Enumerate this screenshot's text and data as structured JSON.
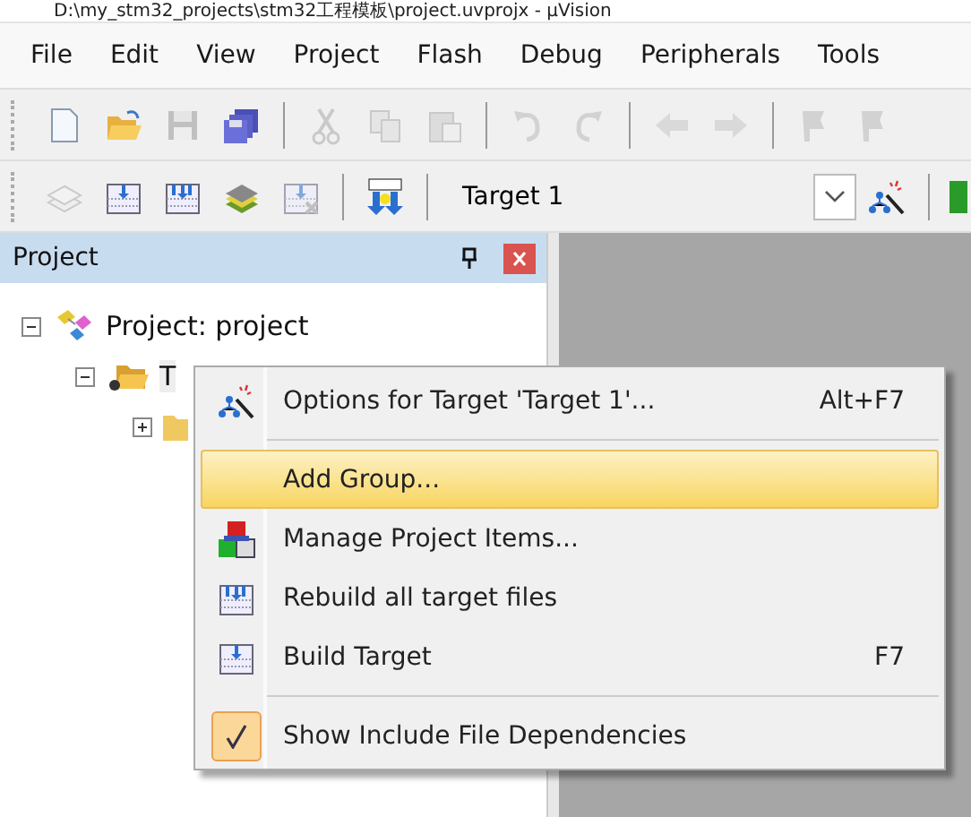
{
  "window": {
    "title": "D:\\my_stm32_projects\\stm32工程模板\\project.uvprojx - µVision"
  },
  "menu": [
    "File",
    "Edit",
    "View",
    "Project",
    "Flash",
    "Debug",
    "Peripherals",
    "Tools"
  ],
  "toolbar": [
    {
      "kind": "new",
      "disabled": false
    },
    {
      "kind": "open",
      "disabled": false
    },
    {
      "kind": "save",
      "disabled": true
    },
    {
      "kind": "saveall",
      "disabled": false
    },
    {
      "kind": "sep"
    },
    {
      "kind": "cut",
      "disabled": true
    },
    {
      "kind": "copy",
      "disabled": true
    },
    {
      "kind": "paste",
      "disabled": true
    },
    {
      "kind": "sep"
    },
    {
      "kind": "undo",
      "disabled": true
    },
    {
      "kind": "redo",
      "disabled": true
    },
    {
      "kind": "sep"
    },
    {
      "kind": "back",
      "disabled": true
    },
    {
      "kind": "forward",
      "disabled": true
    },
    {
      "kind": "sep"
    },
    {
      "kind": "flag",
      "disabled": true
    },
    {
      "kind": "flag",
      "disabled": true
    }
  ],
  "build_toolbar": [
    {
      "kind": "translate",
      "disabled": true
    },
    {
      "kind": "build",
      "disabled": false
    },
    {
      "kind": "rebuild",
      "disabled": false
    },
    {
      "kind": "batch",
      "disabled": false
    },
    {
      "kind": "stop",
      "disabled": true
    },
    {
      "kind": "sep"
    },
    {
      "kind": "load",
      "disabled": false
    },
    {
      "kind": "sep"
    }
  ],
  "target_select": {
    "value": "Target 1"
  },
  "panel": {
    "title": "Project"
  },
  "tree": [
    {
      "label": "Project: project",
      "expanded": true,
      "children": [
        {
          "label": "T",
          "expanded": true,
          "children": [
            {
              "expanded": false
            }
          ]
        }
      ]
    }
  ],
  "context_menu": [
    {
      "kind": "options",
      "label": "Options for Target 'Target 1'...",
      "shortcut": "Alt+F7",
      "selected": false
    },
    {
      "kind": "separator"
    },
    {
      "kind": "plain",
      "label": "Add Group...",
      "selected": true
    },
    {
      "kind": "manage",
      "label": "Manage Project Items...",
      "selected": false
    },
    {
      "kind": "rebuild",
      "label": "Rebuild all target files",
      "selected": false
    },
    {
      "kind": "build",
      "label": "Build Target",
      "shortcut": "F7",
      "selected": false
    },
    {
      "kind": "separator"
    },
    {
      "kind": "toggle",
      "label": "Show Include File Dependencies",
      "selected": false,
      "checked": true
    }
  ]
}
